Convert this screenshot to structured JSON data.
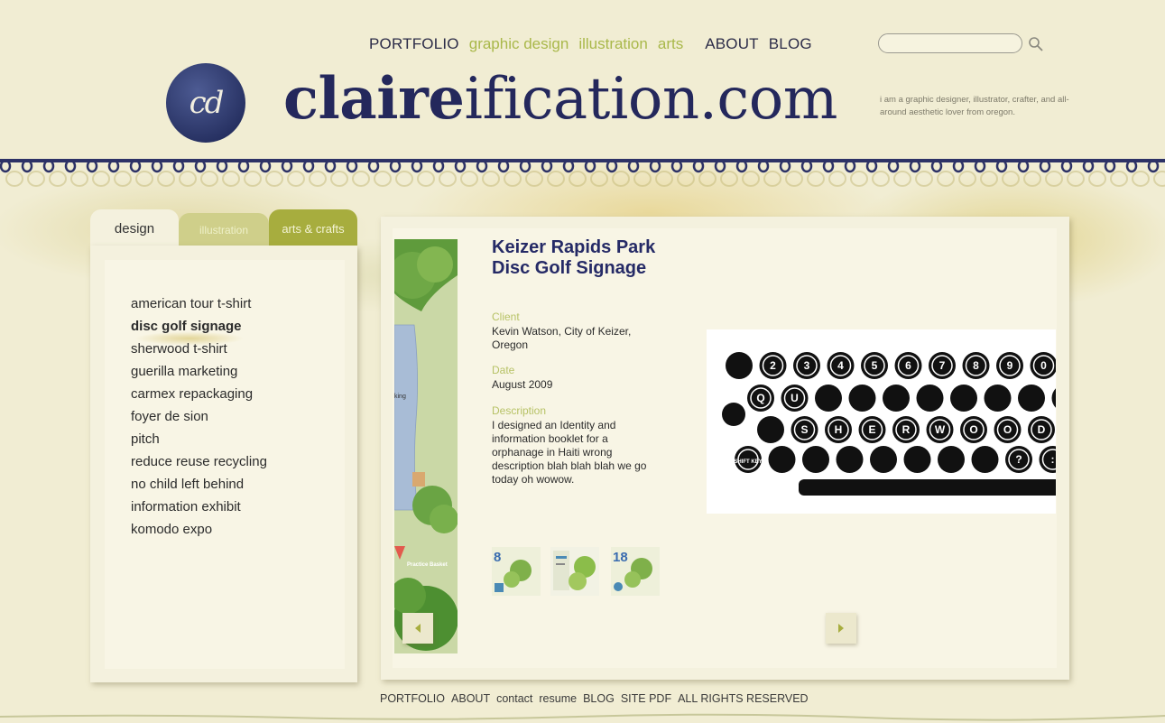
{
  "nav": {
    "portfolio": "PORTFOLIO",
    "sub_items": [
      "graphic design",
      "illustration",
      "arts"
    ],
    "about": "ABOUT",
    "blog": "BLOG",
    "search_placeholder": ""
  },
  "header": {
    "logo_text": "cd",
    "title_bold": "claire",
    "title_light": "ification.com",
    "tagline": "i am a graphic designer, illustrator, crafter, and all-around aesthetic lover from oregon."
  },
  "tabs": [
    "design",
    "illustration",
    "arts & crafts"
  ],
  "projects": [
    "american tour t-shirt",
    "disc golf signage",
    "sherwood t-shirt",
    "guerilla marketing",
    "carmex repackaging",
    "foyer de sion",
    "pitch",
    "reduce reuse recycling",
    "no child left behind",
    "information exhibit",
    "komodo expo"
  ],
  "active_project_index": 1,
  "detail": {
    "title": "Keizer Rapids Park Disc Golf Signage",
    "client_label": "Client",
    "client": "Kevin Watson, City of Keizer, Oregon",
    "date_label": "Date",
    "date": "August 2009",
    "description_label": "Description",
    "description": "I designed an Identity and information booklet for a orphanage in Haiti wrong description blah blah blah we go today oh wowow."
  },
  "map_labels": [
    "king",
    "Practice Basket"
  ],
  "thumbnails": [
    "8",
    "",
    "18"
  ],
  "typewriter_keys": {
    "row1": [
      "",
      "2",
      "3",
      "4",
      "5",
      "6",
      "7",
      "8",
      "9",
      "0"
    ],
    "row2": [
      "Q",
      "U",
      "",
      "",
      "",
      "",
      "",
      "",
      "",
      ""
    ],
    "row3": [
      "",
      "S",
      "H",
      "E",
      "R",
      "W",
      "O",
      "O",
      "D",
      ""
    ],
    "row4": [
      "SHIFT KEY",
      "",
      "",
      "",
      "",
      "",
      "",
      "",
      "?",
      ":"
    ]
  },
  "footer": [
    "PORTFOLIO",
    "ABOUT",
    "contact",
    "resume",
    "BLOG",
    "SITE PDF",
    "ALL RIGHTS RESERVED"
  ],
  "colors": {
    "background": "#f1edd3",
    "navy": "#24285c",
    "accent_green": "#a9b84a",
    "panel": "#f4f1de"
  }
}
